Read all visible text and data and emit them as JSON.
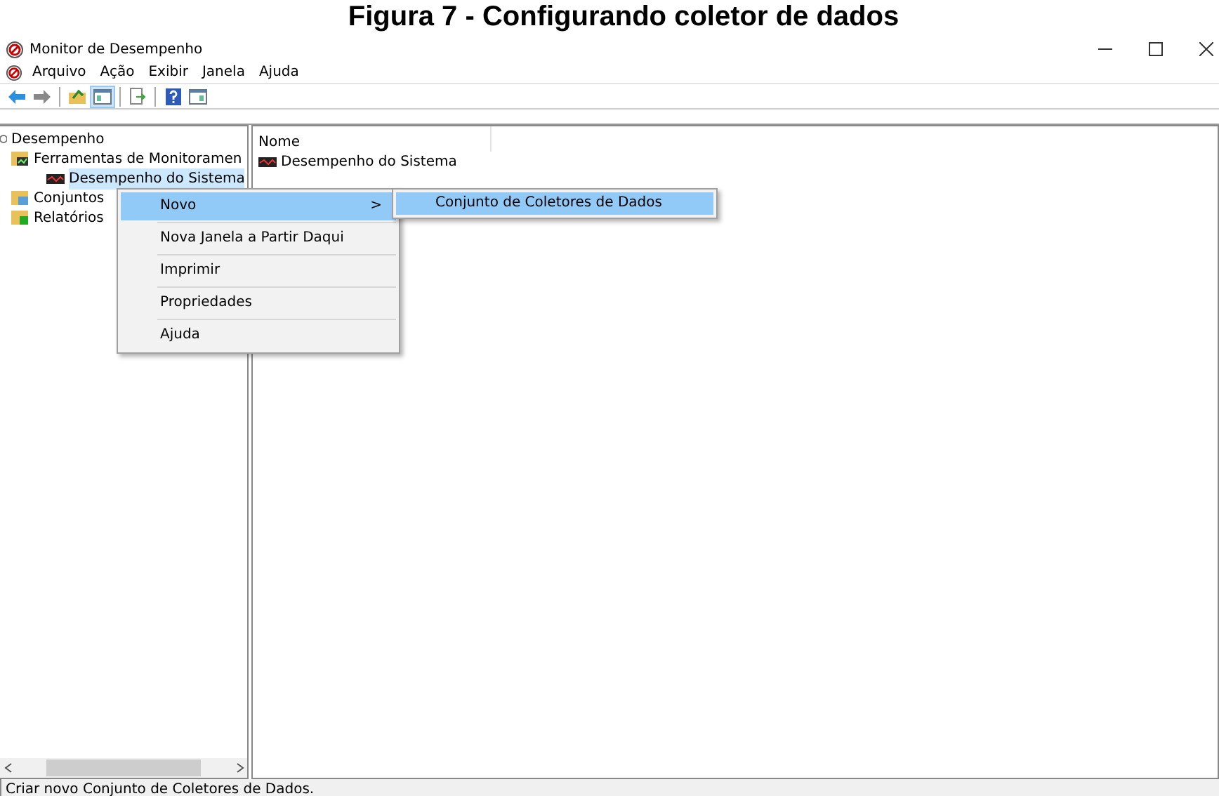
{
  "caption": "Figura 7 - Configurando coletor de dados",
  "window": {
    "title": "Monitor de Desempenho"
  },
  "menu_bar": [
    "Arquivo",
    "Ação",
    "Exibir",
    "Janela",
    "Ajuda"
  ],
  "toolbar": [
    {
      "kind": "back"
    },
    {
      "kind": "forward"
    },
    {
      "kind": "sep"
    },
    {
      "kind": "up"
    },
    {
      "kind": "console",
      "selected": true
    },
    {
      "kind": "sep"
    },
    {
      "kind": "export"
    },
    {
      "kind": "sep"
    },
    {
      "kind": "help"
    },
    {
      "kind": "pane"
    }
  ],
  "tree": [
    {
      "label": "Desempenho",
      "kind": "root",
      "selected": false,
      "children": [
        {
          "label": "Ferramentas de Monitoramen",
          "kind": "tools",
          "selected": false,
          "children": [
            {
              "label": "Desempenho do Sistema",
              "kind": "monitor",
              "selected": true
            }
          ]
        },
        {
          "label": "Conjuntos",
          "kind": "sets",
          "selected": false
        },
        {
          "label": "Relatórios",
          "kind": "reports",
          "selected": false
        }
      ]
    }
  ],
  "list": {
    "columns": [
      "Nome"
    ],
    "rows": [
      {
        "name": "Desempenho do Sistema"
      }
    ]
  },
  "context_menu": [
    {
      "label": "Novo",
      "selected": true,
      "submenu": true
    },
    {
      "label": "Nova Janela a Partir Daqui",
      "selected": false,
      "submenu": false
    },
    {
      "label": "Imprimir",
      "selected": false,
      "submenu": false
    },
    {
      "label": "Propriedades",
      "selected": false,
      "submenu": false
    },
    {
      "label": "Ajuda",
      "selected": false,
      "submenu": false
    }
  ],
  "submenu_arrow": ">",
  "submenu": [
    {
      "label": "Conjunto de Coletores de Dados",
      "selected": true
    }
  ],
  "status_bar": "Criar novo Conjunto de Coletores de Dados."
}
